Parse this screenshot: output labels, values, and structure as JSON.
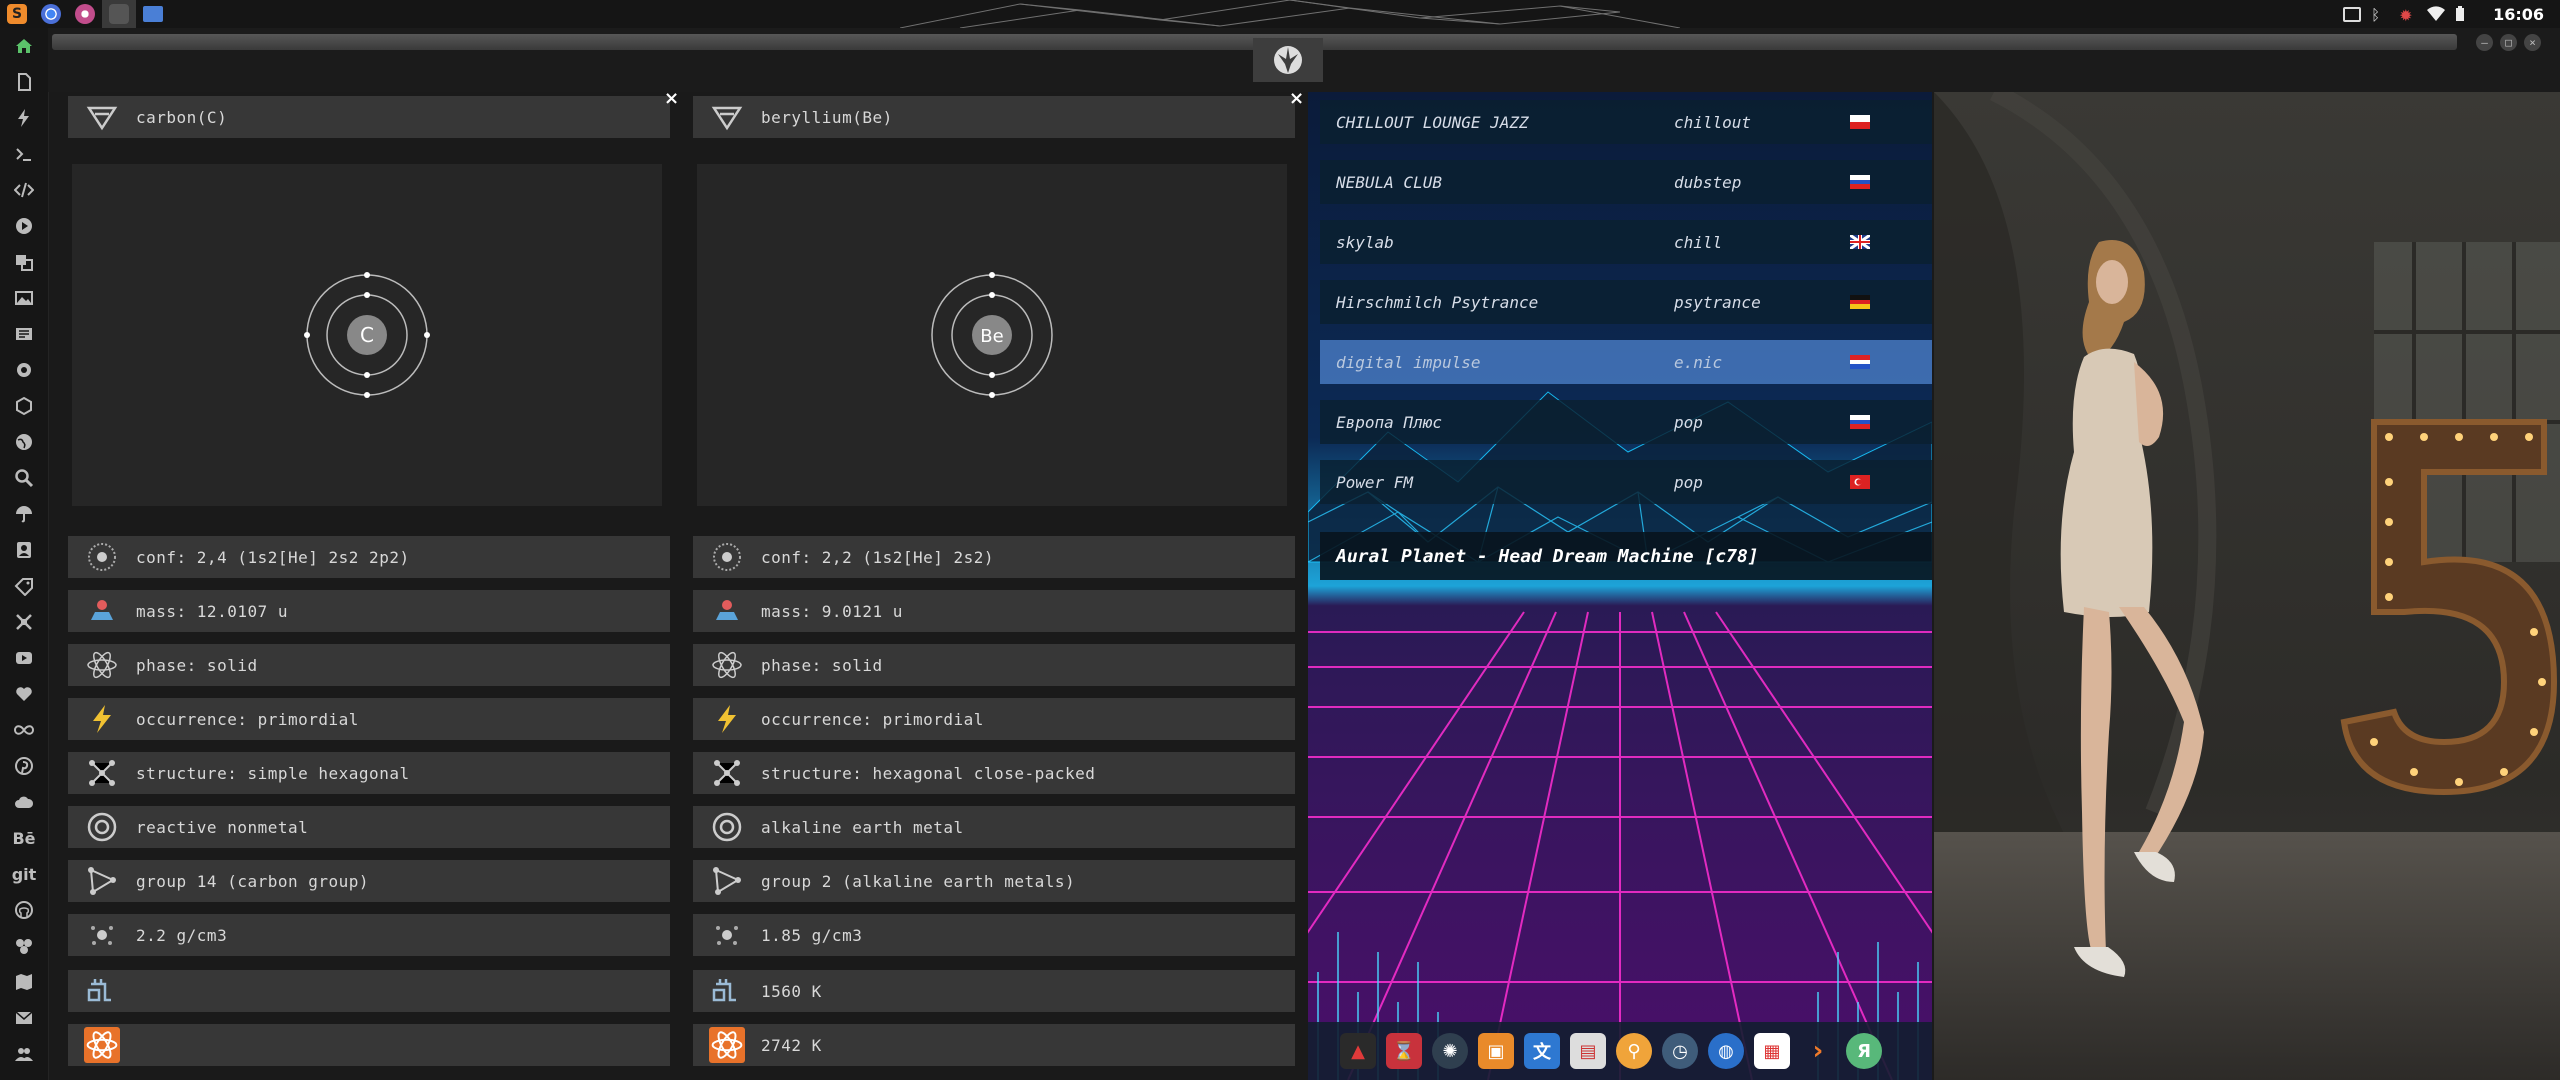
{
  "topbar": {
    "clock": "16:06",
    "apps": [
      "sublime-text-icon",
      "chrome-icon",
      "browser-icon",
      "workspace-icon",
      "files-icon"
    ]
  },
  "leftdock": {
    "items": [
      "home-icon",
      "document-icon",
      "lightning-icon",
      "terminal-icon",
      "code-icon",
      "play-icon",
      "translate-icon",
      "image-icon",
      "news-icon",
      "settings-icon",
      "react-icon",
      "globe-icon",
      "search-icon",
      "umbrella-icon",
      "contacts-icon",
      "tag-icon",
      "crop-icon",
      "youtube-icon",
      "heart-icon",
      "infinity-icon",
      "pinterest-icon",
      "cloud-icon",
      "behance-icon",
      "git-icon",
      "github-icon",
      "sliders-icon",
      "map-icon",
      "mail-icon",
      "people-icon"
    ],
    "behance_label": "Bē",
    "git_label": "git"
  },
  "elements": [
    {
      "name": "carbon(C)",
      "symbol": "C",
      "conf": "conf: 2,4 (1s2[He] 2s2 2p2)",
      "mass": "mass: 12.0107 u",
      "phase": "phase: solid",
      "occurrence": "occurrence: primordial",
      "structure": "structure: simple hexagonal",
      "category": "reactive nonmetal",
      "group": "group 14 (carbon group)",
      "density": "2.2 g/cm3",
      "melting": "",
      "boiling": "",
      "shells": [
        2,
        4
      ]
    },
    {
      "name": "beryllium(Be)",
      "symbol": "Be",
      "conf": "conf: 2,2 (1s2[He] 2s2)",
      "mass": "mass: 9.0121 u",
      "phase": "phase: solid",
      "occurrence": "occurrence: primordial",
      "structure": "structure: hexagonal close-packed",
      "category": "alkaline earth metal",
      "group": "group 2 (alkaline earth metals)",
      "density": "1.85 g/cm3",
      "melting": "1560 K",
      "boiling": "2742 K",
      "shells": [
        2,
        2
      ]
    }
  ],
  "close_glyph": "×",
  "radio": {
    "stations": [
      {
        "name": "CHILLOUT LOUNGE JAZZ",
        "genre": "chillout",
        "flag": "pl"
      },
      {
        "name": "NEBULA CLUB",
        "genre": "dubstep",
        "flag": "ru"
      },
      {
        "name": "skylab",
        "genre": "chill",
        "flag": "gb"
      },
      {
        "name": "Hirschmilch Psytrance",
        "genre": "psytrance",
        "flag": "de"
      },
      {
        "name": "digital impulse",
        "genre": "e.nic",
        "flag": "hr"
      },
      {
        "name": "Европа Плюс",
        "genre": "pop",
        "flag": "ru"
      },
      {
        "name": "Power FM",
        "genre": "pop",
        "flag": "tr"
      }
    ],
    "selected_index": 4,
    "now_playing": "Aural Planet - Head Dream Machine [c78]"
  },
  "bottomdock": {
    "items": [
      "app-a-icon",
      "hourglass-icon",
      "octopus-icon",
      "image-viewer-icon",
      "translate-icon",
      "cards-icon",
      "magnifier-icon",
      "clock-icon",
      "globe-icon",
      "calendar-icon",
      "arrow-icon",
      "yandex-icon"
    ],
    "yandex_label": "Я"
  },
  "colors": {
    "accent": "#e8722a",
    "selected_station": "#4678be",
    "panel_row": "#373737"
  }
}
